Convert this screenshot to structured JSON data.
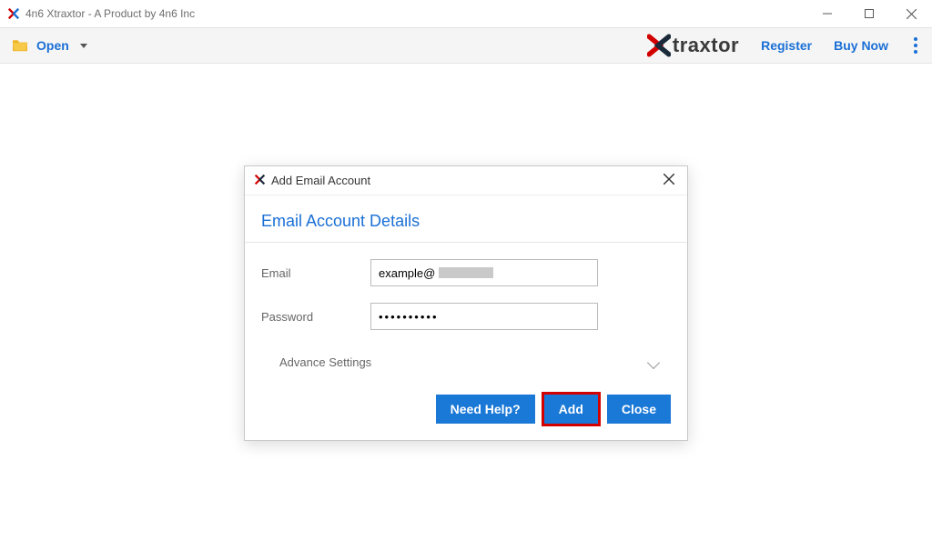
{
  "window": {
    "title": "4n6 Xtraxtor - A Product by 4n6 Inc"
  },
  "toolbar": {
    "open_label": "Open",
    "register_label": "Register",
    "buy_now_label": "Buy Now",
    "brand_text": "traxtor"
  },
  "dialog": {
    "title": "Add Email Account",
    "heading": "Email Account Details",
    "email_label": "Email",
    "email_value_visible": "example@",
    "password_label": "Password",
    "password_value": "••••••••••",
    "advance_label": "Advance Settings",
    "need_help_label": "Need Help?",
    "add_label": "Add",
    "close_label": "Close"
  },
  "colors": {
    "accent_blue": "#1a6fd6",
    "button_blue": "#1a78d6",
    "highlight_red": "#d30000"
  }
}
